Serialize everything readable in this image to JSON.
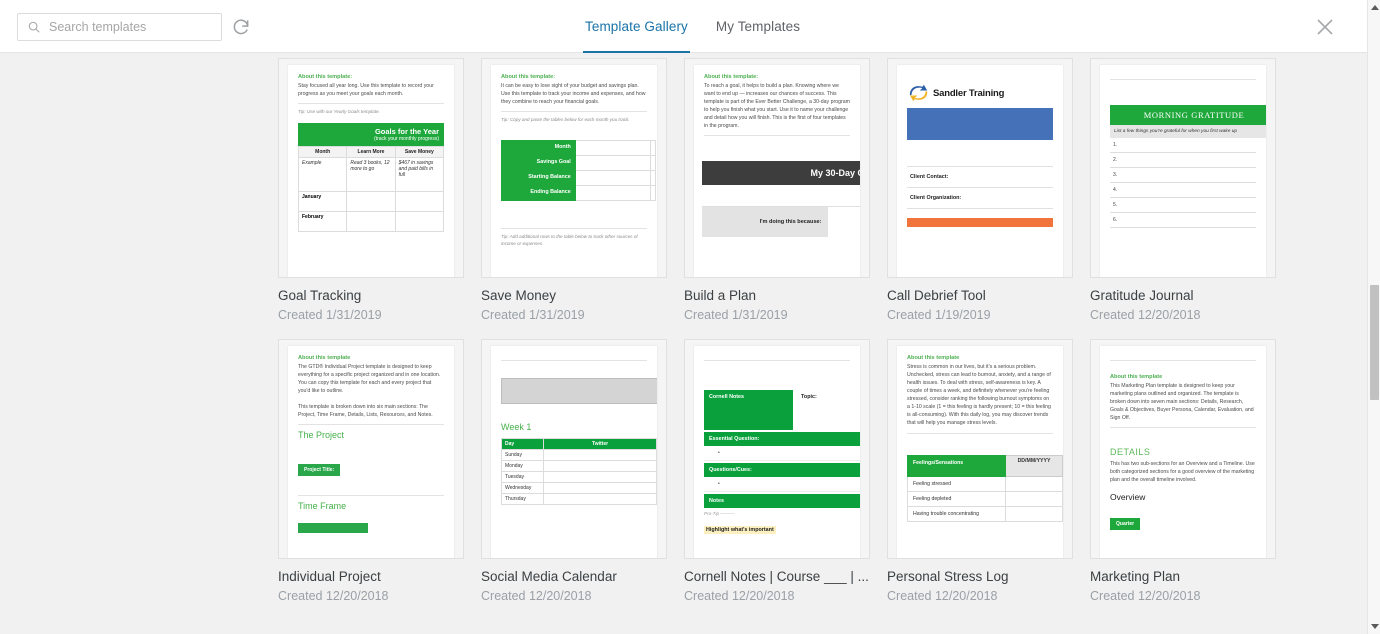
{
  "header": {
    "search": {
      "placeholder": "Search templates",
      "value": ""
    },
    "refresh_title": "Refresh",
    "close_title": "Close",
    "tabs": [
      {
        "label": "Template Gallery",
        "active": true
      },
      {
        "label": "My Templates",
        "active": false
      }
    ]
  },
  "cards": [
    {
      "title": "Goal Tracking",
      "date": "Created 1/31/2019",
      "about_heading": "About this template:",
      "about_body": "Stay focused all year long. Use this template to record your progress as you meet your goals each month.",
      "tip": "Tip: Use with our Yearly Goals template.",
      "table_title": "Goals for the Year",
      "table_subtitle": "(track your monthly progress)",
      "columns": [
        "Month",
        "Learn More",
        "Save Money"
      ],
      "rows": [
        [
          "Example",
          "Read 3 books, 12 more to go",
          "$467 in savings and paid bills in full"
        ],
        [
          "January",
          "",
          ""
        ],
        [
          "February",
          "",
          ""
        ]
      ]
    },
    {
      "title": "Save Money",
      "date": "Created 1/31/2019",
      "about_heading": "About this template:",
      "about_body": "It can be easy to lose sight of your budget and savings plan. Use this template to track your income and expenses, and how they combine to reach your financial goals.",
      "tip": "Tip: Copy and paste the tables below for each month you track.",
      "labels": [
        "Month",
        "Savings Goal",
        "Starting Balance",
        "Ending Balance"
      ],
      "tip2": "Tip: Add additional rows to the table below to track other sources of income or expenses."
    },
    {
      "title": "Build a Plan",
      "date": "Created 1/31/2019",
      "about_heading": "About this template:",
      "about_body": "To reach a goal, it helps to build a plan. Knowing where we want to end up — increases our chances of success. This template is part of the Ever Better Challenge, a 30-day program to help you finish what you start. Use it to name your challenge and detail how you will finish. This is the first of four templates in the program.",
      "banner": "My 30-Day C",
      "field_label": "I'm doing this because:"
    },
    {
      "title": "Call Debrief Tool",
      "date": "Created 1/19/2019",
      "logo_text": "Sandler Training",
      "fields": [
        "Client Contact:",
        "Client Organization:"
      ]
    },
    {
      "title": "Gratitude Journal",
      "date": "Created 12/20/2018",
      "banner": "MORNING GRATITUDE",
      "instruction": "List a few things you're grateful for when you first wake up",
      "lines": [
        "1.",
        "2.",
        "3.",
        "4.",
        "5.",
        "6."
      ]
    },
    {
      "title": "Individual Project",
      "date": "Created 12/20/2018",
      "about_heading": "About this template",
      "about_body": "The GTD® Individual Project template is designed to keep everything for a specific project organized and in one location. You can copy this template for each and every project that you'd like to outline.",
      "about_body2": "This template is broken down into six main sections: The Project, Time Frame, Details, Lists, Resources, and Notes.",
      "section1": "The Project",
      "badge1": "Project Title:",
      "section2": "Time Frame"
    },
    {
      "title": "Social Media Calendar",
      "date": "Created 12/20/2018",
      "week_heading": "Week 1",
      "columns": [
        "Day",
        "Twitter"
      ],
      "rows": [
        "Sunday",
        "Monday",
        "Tuesday",
        "Wednesday",
        "Thursday"
      ]
    },
    {
      "title": "Cornell Notes | Course ___ | ...",
      "date": "Created 12/20/2018",
      "box_label": "Cornell Notes",
      "topic_label": "Topic:",
      "bars": [
        "Essential Question:",
        "Questions/Cues:",
        "Notes"
      ],
      "bullet": "•",
      "pro_tip": "Pro-Tip ———",
      "highlight": "Highlight what's important"
    },
    {
      "title": "Personal Stress Log",
      "date": "Created 12/20/2018",
      "about_heading": "About this template",
      "about_body": "Stress is common in our lives, but it's a serious problem. Unchecked, stress can lead to burnout, anxiety, and a range of health issues. To deal with stress, self-awareness is key. A couple of times a week, and definitely whenever you're feeling stressed, consider ranking the following burnout symptoms on a 1-10 scale (1 = this feeling is hardly present; 10 = this feeling is all-consuming). With this daily log, you may discover trends that will help you manage stress levels.",
      "table_header": "Feelings/Sensations",
      "date_column": "DD/MM/YYYY",
      "rows": [
        "Feeling stressed",
        "Feeling depleted",
        "Having trouble concentrating"
      ]
    },
    {
      "title": "Marketing Plan",
      "date": "Created 12/20/2018",
      "about_heading": "About this template",
      "about_body": "This Marketing Plan template is designed to keep your marketing plans outlined and organized. The template is broken down into seven main sections: Details, Research, Goals & Objectives, Buyer Persona, Calendar, Evaluation, and Sign Off.",
      "section_heading": "DETAILS",
      "section_body": "This has two sub-sections for an Overview and a Timeline. Use both categorized sections for a good overview of the marketing plan and the overall timeline involved.",
      "subheading": "Overview",
      "badge": "Quarter"
    }
  ],
  "colors": {
    "accent_blue": "#1a73a7",
    "green": "#1ea83c",
    "page_bg": "#f1f1f1"
  }
}
